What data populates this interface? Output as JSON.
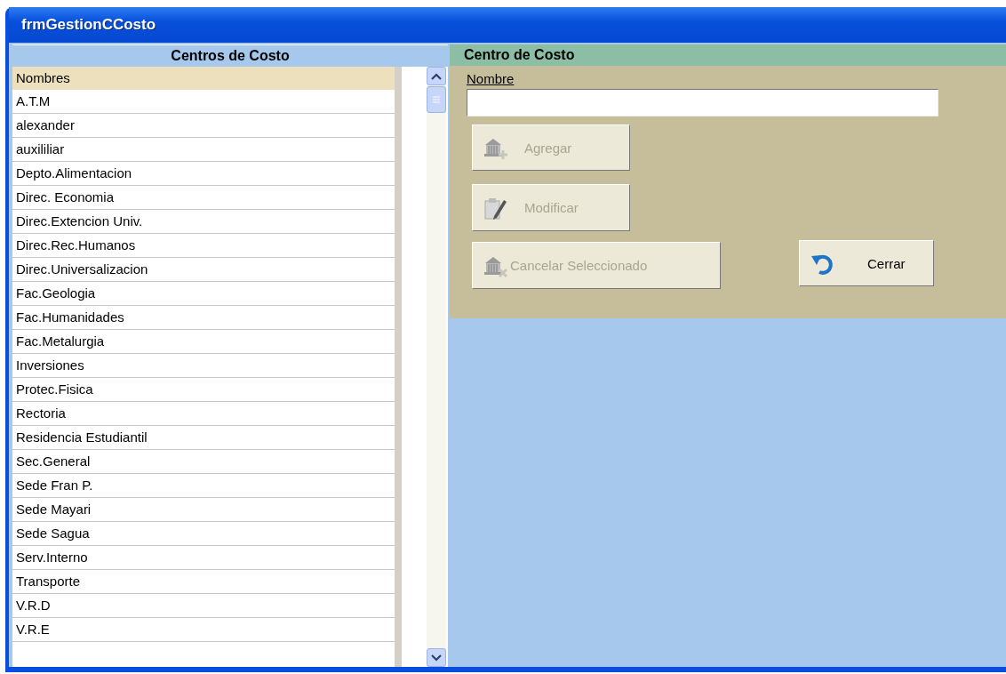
{
  "window": {
    "title": "frmGestionCCosto"
  },
  "list_panel": {
    "title": "Centros de Costo",
    "column": "Nombres",
    "rows": [
      "A.T.M",
      "alexander",
      "auxililiar",
      "Depto.Alimentacion",
      "Direc. Economia",
      "Direc.Extencion Univ.",
      "Direc.Rec.Humanos",
      "Direc.Universalizacion",
      "Fac.Geologia",
      "Fac.Humanidades",
      "Fac.Metalurgia",
      "Inversiones",
      "Protec.Fisica",
      "Rectoria",
      "Residencia Estudiantil",
      "Sec.General",
      "Sede Fran P.",
      "Sede Mayari",
      "Sede Sagua",
      "Serv.Interno",
      "Transporte",
      "V.R.D",
      "V.R.E"
    ]
  },
  "detail_panel": {
    "title": "Centro de Costo",
    "field": {
      "label": "Nombre"
    },
    "buttons": [
      {
        "label": "Agregar",
        "disabled": true
      },
      {
        "label": "Modificar",
        "disabled": true
      },
      {
        "label": "Cancelar Seleccionado",
        "disabled": true
      },
      {
        "label": "Cerrar",
        "disabled": false
      }
    ]
  }
}
